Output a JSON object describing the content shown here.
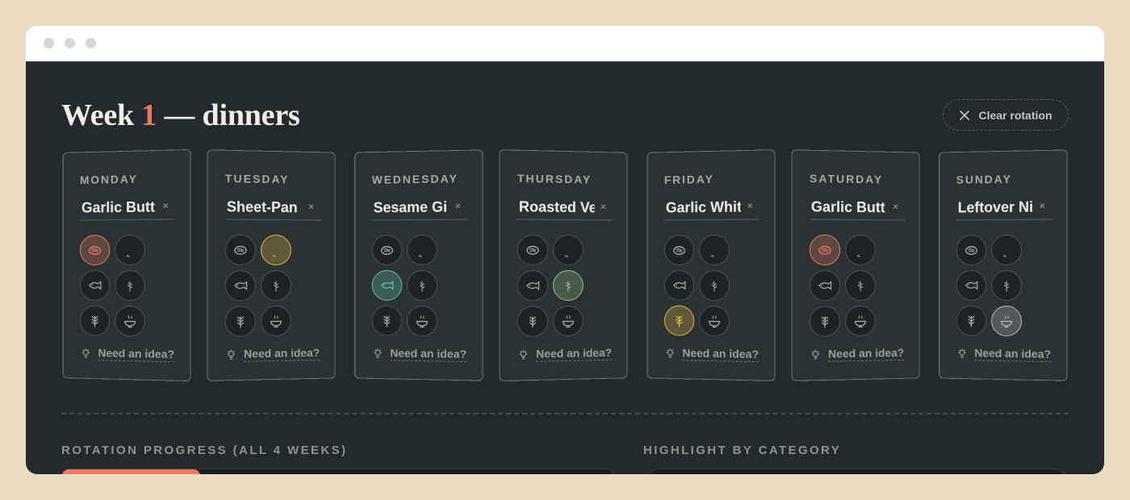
{
  "window": {
    "title_prefix": "Week",
    "week_number": "1",
    "title_suffix": "— dinners"
  },
  "clear_button": {
    "label": "Clear rotation",
    "icon": "close-icon"
  },
  "categories": [
    "steak",
    "chicken",
    "fish",
    "leaf",
    "grain",
    "bowl"
  ],
  "colors": {
    "steak": "#ea7b62",
    "chicken": "#e6b94a",
    "fish": "#66c4b5",
    "leaf": "#95c58a",
    "grain": "#e6b94a",
    "bowl": "#b9bcbc",
    "accent": "#ea7b62"
  },
  "days": [
    {
      "name": "MONDAY",
      "meal": "Garlic Butt",
      "remove": "×",
      "selected": "steak",
      "idea": "Need an idea?"
    },
    {
      "name": "TUESDAY",
      "meal": "Sheet-Pan",
      "remove": "×",
      "selected": "chicken",
      "idea": "Need an idea?"
    },
    {
      "name": "WEDNESDAY",
      "meal": "Sesame Gi",
      "remove": "×",
      "selected": "fish",
      "idea": "Need an idea?"
    },
    {
      "name": "THURSDAY",
      "meal": "Roasted Ve",
      "remove": "×",
      "selected": "leaf",
      "idea": "Need an idea?"
    },
    {
      "name": "FRIDAY",
      "meal": "Garlic Whit",
      "remove": "×",
      "selected": "grain",
      "idea": "Need an idea?"
    },
    {
      "name": "SATURDAY",
      "meal": "Garlic Butt",
      "remove": "×",
      "selected": "steak",
      "idea": "Need an idea?"
    },
    {
      "name": "SUNDAY",
      "meal": "Leftover Ni",
      "remove": "×",
      "selected": "bowl",
      "idea": "Need an idea?"
    }
  ],
  "rotation_progress": {
    "label": "ROTATION PROGRESS (ALL 4 WEEKS)",
    "fraction": 0.25
  },
  "highlight": {
    "label": "HIGHLIGHT BY CATEGORY"
  }
}
